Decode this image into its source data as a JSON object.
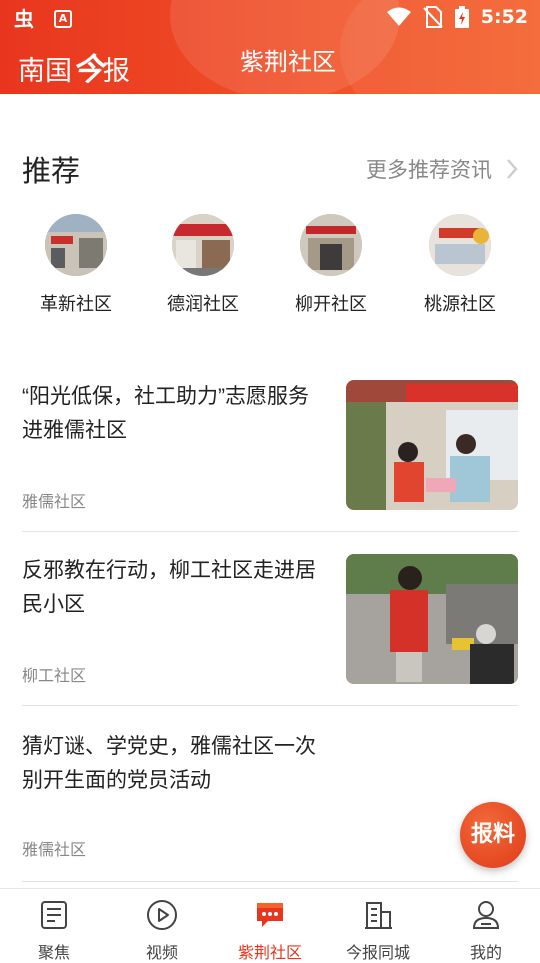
{
  "status_bar": {
    "time": "5:52"
  },
  "header": {
    "brand_part1": "南国",
    "brand_part2": "今",
    "brand_part3": "报",
    "title": "紫荆社区"
  },
  "recommend": {
    "heading": "推荐",
    "more_label": "更多推荐资讯"
  },
  "communities": [
    {
      "name": "革新社区"
    },
    {
      "name": "德润社区"
    },
    {
      "name": "柳开社区"
    },
    {
      "name": "桃源社区"
    }
  ],
  "news": [
    {
      "title": "“阳光低保，社工助力”志愿服务进雅儒社区",
      "source": "雅儒社区"
    },
    {
      "title": "反邪教在行动，柳工社区走进居民小区",
      "source": "柳工社区"
    },
    {
      "title": "猜灯谜、学党史，雅儒社区一次别开生面的党员活动",
      "source": "雅儒社区"
    }
  ],
  "fab": {
    "label": "报料"
  },
  "tabs": [
    {
      "label": "聚焦",
      "icon": "news-icon"
    },
    {
      "label": "视频",
      "icon": "play-icon"
    },
    {
      "label": "紫荆社区",
      "icon": "chat-icon"
    },
    {
      "label": "今报同城",
      "icon": "building-icon"
    },
    {
      "label": "我的",
      "icon": "user-icon"
    }
  ],
  "colors": {
    "accent": "#e8361e",
    "header_end": "#f4622e"
  }
}
